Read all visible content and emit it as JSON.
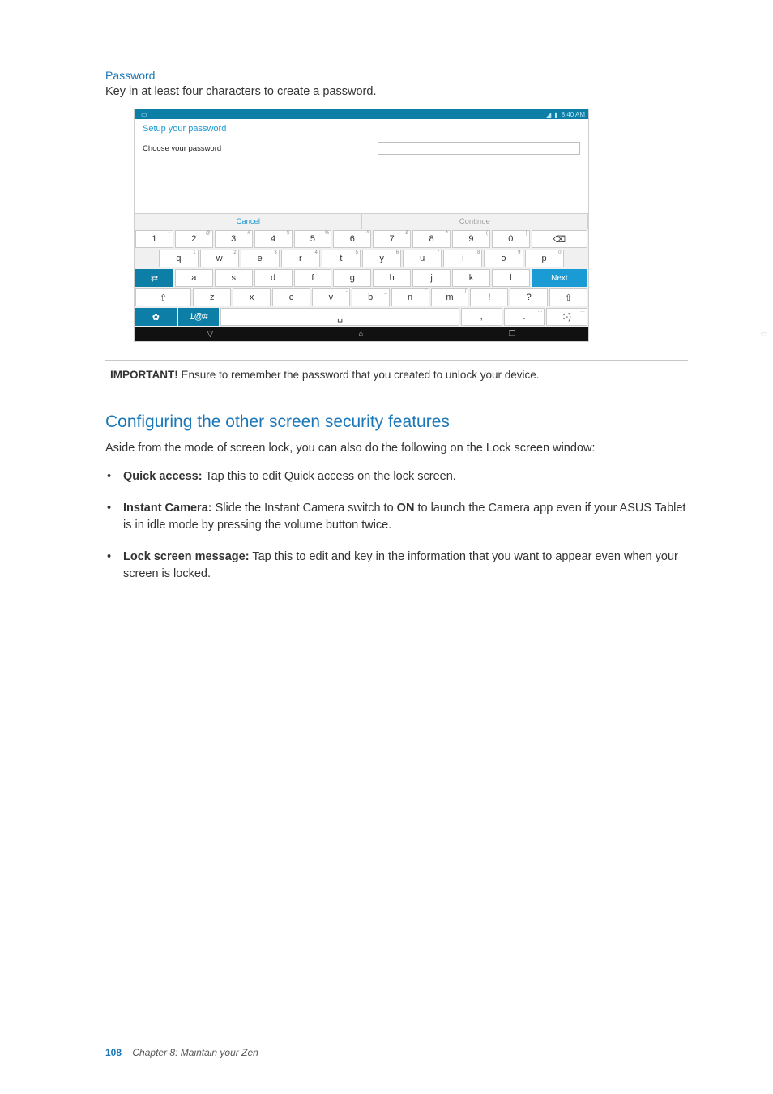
{
  "section_title": "Password",
  "section_body": "Key in at least four characters to create a password.",
  "screenshot": {
    "statusbar": {
      "time": "8:40 AM"
    },
    "setup_title": "Setup your password",
    "choose_label": "Choose your password",
    "cancel": "Cancel",
    "continue": "Continue",
    "kb": {
      "row1": [
        {
          "k": "1",
          "s": "~"
        },
        {
          "k": "2",
          "s": "@"
        },
        {
          "k": "3",
          "s": "#"
        },
        {
          "k": "4",
          "s": "$"
        },
        {
          "k": "5",
          "s": "%"
        },
        {
          "k": "6",
          "s": "^"
        },
        {
          "k": "7",
          "s": "&"
        },
        {
          "k": "8",
          "s": "*"
        },
        {
          "k": "9",
          "s": "("
        },
        {
          "k": "0",
          "s": ")"
        }
      ],
      "row2": [
        {
          "k": "q",
          "s": "1"
        },
        {
          "k": "w",
          "s": "2"
        },
        {
          "k": "e",
          "s": "3"
        },
        {
          "k": "r",
          "s": "4"
        },
        {
          "k": "t",
          "s": "5"
        },
        {
          "k": "y",
          "s": "6"
        },
        {
          "k": "u",
          "s": "7"
        },
        {
          "k": "i",
          "s": "8"
        },
        {
          "k": "o",
          "s": "9"
        },
        {
          "k": "p",
          "s": "0"
        }
      ],
      "row3": [
        {
          "k": "a"
        },
        {
          "k": "s"
        },
        {
          "k": "d"
        },
        {
          "k": "f"
        },
        {
          "k": "g"
        },
        {
          "k": "h"
        },
        {
          "k": "j"
        },
        {
          "k": "k"
        },
        {
          "k": "l"
        }
      ],
      "row3_next": "Next",
      "row4": [
        {
          "k": "z"
        },
        {
          "k": "x"
        },
        {
          "k": "c"
        },
        {
          "k": "v",
          "s": "-"
        },
        {
          "k": "b",
          "s": "_"
        },
        {
          "k": "n",
          "s": "'"
        },
        {
          "k": "m",
          "s": "/"
        },
        {
          "k": "!"
        },
        {
          "k": "?"
        }
      ],
      "row4_shift_right": "⇧",
      "row5": {
        "sym": "1@#",
        "comma": ",",
        "dot": ".",
        "emoji": ":-)"
      },
      "backspace": "⌫"
    }
  },
  "callout": {
    "label": "IMPORTANT!",
    "text": " Ensure to remember the password that you created to unlock your device."
  },
  "h2": "Configuring the other screen security features",
  "intro": "Aside from the mode of screen lock, you can also do the following on the Lock screen window:",
  "bullets": [
    {
      "b": "Quick access:",
      "t": " Tap this to edit Quick access on the lock screen."
    },
    {
      "b": "Instant Camera:",
      "t_pre": " Slide the Instant Camera switch to ",
      "b2": "ON",
      "t_post": " to launch the Camera app even if your ASUS Tablet is in idle mode by pressing the volume button twice."
    },
    {
      "b": "Lock screen message:",
      "t": " Tap this to edit and key in the information that you want to appear even when your screen is locked."
    }
  ],
  "footer": {
    "page": "108",
    "chapter": "Chapter 8: Maintain your Zen"
  }
}
